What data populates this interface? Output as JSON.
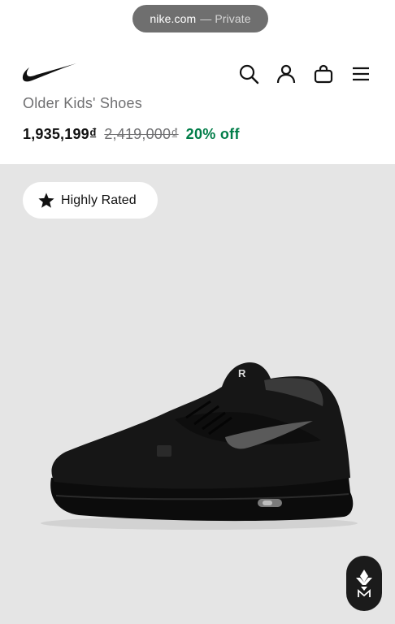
{
  "browser": {
    "domain": "nike.com",
    "separator": "—",
    "mode": "Private"
  },
  "header": {
    "logo_icon": "nike-swoosh-logo",
    "icons": [
      "search-icon",
      "account-icon",
      "bag-icon",
      "menu-icon"
    ]
  },
  "product": {
    "subtitle": "Older Kids' Shoes",
    "price_current": "1,935,199₫",
    "price_original": "2,419,000₫",
    "discount": "20% off",
    "discount_color": "#007d48"
  },
  "media": {
    "badge_label": "Highly Rated",
    "badge_icon": "star-icon",
    "image_subject": "black high-top sneaker",
    "background": "#e5e5e5",
    "floating_button_icon": "assistant-icon"
  }
}
